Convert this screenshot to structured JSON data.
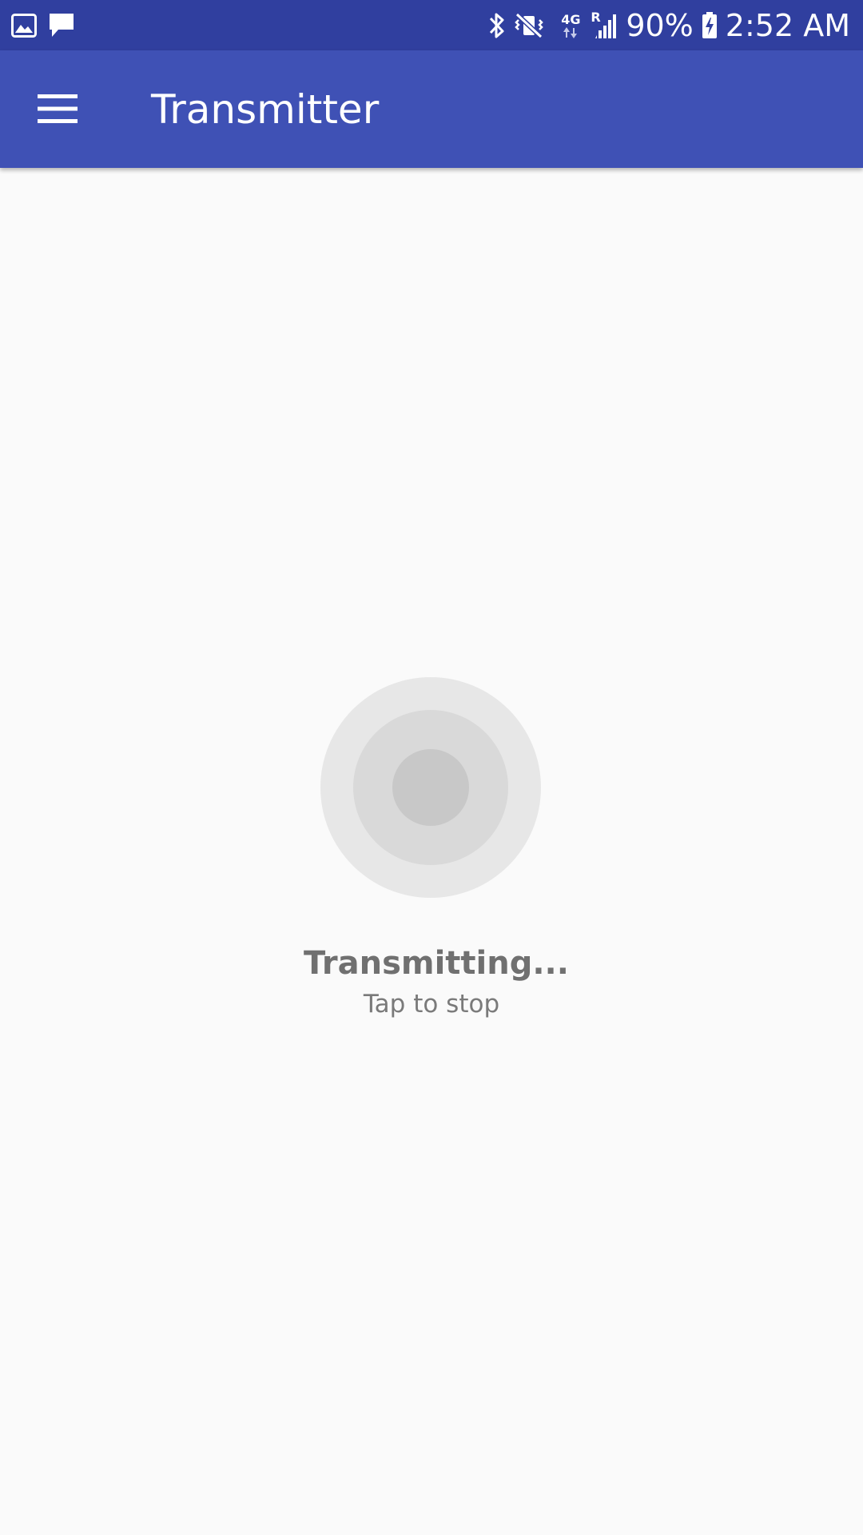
{
  "status_bar": {
    "left_icons": [
      "gallery-notification-icon",
      "message-notification-icon"
    ],
    "right_icons": [
      "bluetooth-icon",
      "vibrate-mute-icon",
      "network-4g-icon",
      "signal-roaming-icon",
      "battery-charging-icon"
    ],
    "network_label": "4G",
    "roaming_label": "R",
    "battery_percent": "90%",
    "time": "2:52 AM",
    "background_color": "#303f9f"
  },
  "app_bar": {
    "menu_icon": "menu-icon",
    "title": "Transmitter",
    "background_color": "#3f51b5"
  },
  "main": {
    "indicator_icon": "transmit-pulse-icon",
    "status_title": "Transmitting...",
    "status_subtitle": "Tap to stop"
  }
}
